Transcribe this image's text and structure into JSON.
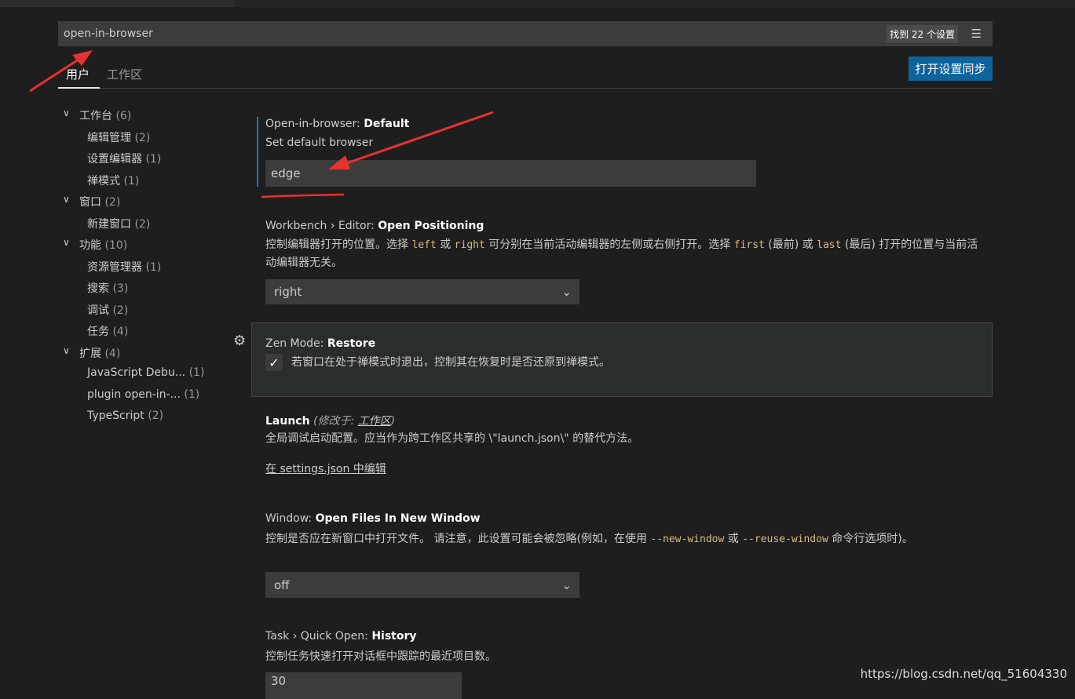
{
  "search": {
    "value": "open-in-browser",
    "result_count": "找到 22 个设置",
    "clear_icon": "clear-filter-icon"
  },
  "tabs": [
    {
      "label": "用户",
      "active": true
    },
    {
      "label": "工作区",
      "active": false
    }
  ],
  "sync_button": "打开设置同步",
  "tree": [
    {
      "label": "工作台",
      "count": "(6)",
      "level": 0
    },
    {
      "label": "编辑管理",
      "count": "(2)",
      "level": 1
    },
    {
      "label": "设置编辑器",
      "count": "(1)",
      "level": 1
    },
    {
      "label": "禅模式",
      "count": "(1)",
      "level": 1
    },
    {
      "label": "窗口",
      "count": "(2)",
      "level": 0
    },
    {
      "label": "新建窗口",
      "count": "(2)",
      "level": 1
    },
    {
      "label": "功能",
      "count": "(10)",
      "level": 0
    },
    {
      "label": "资源管理器",
      "count": "(1)",
      "level": 1
    },
    {
      "label": "搜索",
      "count": "(3)",
      "level": 1
    },
    {
      "label": "调试",
      "count": "(2)",
      "level": 1
    },
    {
      "label": "任务",
      "count": "(4)",
      "level": 1
    },
    {
      "label": "扩展",
      "count": "(4)",
      "level": 0
    },
    {
      "label": "JavaScript Debu...",
      "count": "(1)",
      "level": 1
    },
    {
      "label": "plugin open-in-...",
      "count": "(1)",
      "level": 1
    },
    {
      "label": "TypeScript",
      "count": "(2)",
      "level": 1
    }
  ],
  "settings": {
    "s1": {
      "prefix": "Open-in-browser: ",
      "name": "Default",
      "desc": "Set default browser",
      "value": "edge"
    },
    "s2": {
      "prefix": "Workbench › Editor: ",
      "name": "Open Positioning",
      "d1": "控制编辑器打开的位置。选择 ",
      "c1": "left",
      "d2": " 或 ",
      "c2": "right",
      "d3": " 可分别在当前活动编辑器的左侧或右侧打开。选择 ",
      "c3": "first",
      "d4": " (最前) 或 ",
      "c4": "last",
      "d5": " (最后) 打开的位置与当前活动编辑器无关。",
      "value": "right"
    },
    "s3": {
      "prefix": "Zen Mode: ",
      "name": "Restore",
      "desc": "若窗口在处于禅模式时退出，控制其在恢复时是否还原到禅模式。",
      "checked": true
    },
    "s4": {
      "name": "Launch",
      "modified": "(修改于: ",
      "modified_link": "工作区",
      "modified_end": ")",
      "desc": "全局调试启动配置。应当作为跨工作区共享的 \\\"launch.json\\\" 的替代方法。",
      "link": "在 settings.json 中编辑"
    },
    "s5": {
      "prefix": "Window: ",
      "name": "Open Files In New Window",
      "d1": "控制是否应在新窗口中打开文件。 请注意，此设置可能会被忽略(例如，在使用 ",
      "c1": "--new-window",
      "d2": " 或 ",
      "c2": "--reuse-window",
      "d3": " 命令行选项时)。",
      "value": "off"
    },
    "s6": {
      "prefix": "Task › Quick Open: ",
      "name": "History",
      "desc": "控制任务快速打开对话框中跟踪的最近项目数。",
      "value": "30"
    }
  },
  "watermark": "https://blog.csdn.net/qq_51604330",
  "colors": {
    "accent": "#0e639c",
    "focus_bar": "#007acc",
    "annotation": "#e8322e",
    "code": "#d7ba7d"
  }
}
